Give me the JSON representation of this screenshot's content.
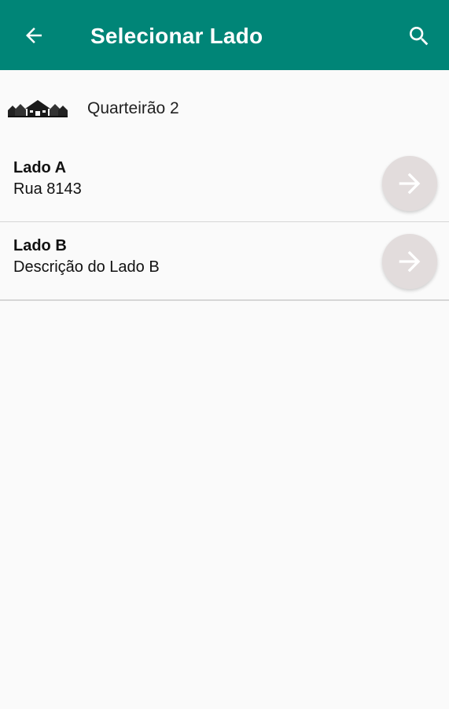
{
  "colors": {
    "app_bar": "#008577",
    "app_bar_text": "#ffffff",
    "background": "#fafafa",
    "divider": "#d6d6d6",
    "fab_background": "#e2dcdc",
    "fab_icon": "#ffffff"
  },
  "app_bar": {
    "title": "Selecionar Lado",
    "back_icon": "arrow-left-icon",
    "search_icon": "search-icon"
  },
  "block": {
    "icon": "houses-icon",
    "name": "Quarteirão 2"
  },
  "sides": [
    {
      "name": "Lado A",
      "description": "Rua 8143",
      "action_icon": "arrow-right-icon"
    },
    {
      "name": "Lado B",
      "description": "Descrição do Lado B",
      "action_icon": "arrow-right-icon"
    }
  ]
}
